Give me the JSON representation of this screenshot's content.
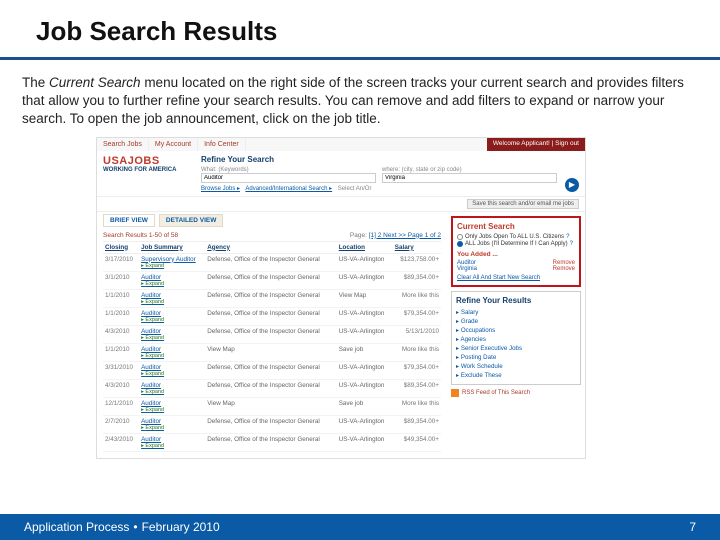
{
  "slide": {
    "title": "Job Search Results",
    "body": "The Current Search menu located on the right side of the screen tracks your current search and provides filters that allow you to further refine your search results.  You can remove and add filters to expand or narrow your search.  To open the job announcement, click on the job title."
  },
  "app": {
    "tabs": [
      "Search Jobs",
      "My Account",
      "Info Center"
    ],
    "welcome": "Welcome Applicant!  |  Sign out",
    "logo_l1": "USAJOBS",
    "logo_l2": "WORKING FOR AMERICA",
    "refine_label": "Refine Your Search",
    "what_label": "What: (Keywords)",
    "what_value": "Auditor",
    "where_label": "where: (city, state or zip code)",
    "where_value": "Virginia",
    "browse": "Browse Jobs ▸",
    "adv": "Advanced/International Search ▸",
    "any": "Select An/Or",
    "save_btn": "Save this search and/or email me jobs",
    "brief": "BRIEF VIEW",
    "detailed": "DETAILED VIEW",
    "sr_count": "Search Results 1-50 of 58",
    "page_lbl": "Page:",
    "page_links": "[1]  2   Next >>     Page 1 of 2",
    "cols": [
      "Closing",
      "Job Summary",
      "Agency",
      "Location",
      "Salary"
    ],
    "rows": [
      {
        "date": "3/17/2010",
        "title": "Supervisory Auditor",
        "agency": "Defense, Office of the Inspector General",
        "loc": "US-VA-Arlington",
        "sal": "$123,758.00+"
      },
      {
        "date": "3/1/2010",
        "title": "Auditor",
        "agency": "Defense, Office of the Inspector General",
        "loc": "US-VA-Arlington",
        "sal": "$89,354.00+"
      },
      {
        "date": "1/1/2010",
        "title": "Auditor",
        "agency": "Defense, Office of the Inspector General",
        "loc": "View Map",
        "sal": "More like this"
      },
      {
        "date": "1/1/2010",
        "title": "Auditor",
        "agency": "Defense, Office of the Inspector General",
        "loc": "US-VA-Arlington",
        "sal": "$79,354.00+"
      },
      {
        "date": "4/3/2010",
        "title": "Auditor",
        "agency": "Defense, Office of the Inspector General",
        "loc": "US-VA-Arlington",
        "sal": "5/13/1/2010"
      },
      {
        "date": "1/1/2010",
        "title": "Auditor",
        "agency": "View Map",
        "loc": "Save job",
        "sal": "More like this"
      },
      {
        "date": "3/31/2010",
        "title": "Auditor",
        "agency": "Defense, Office of the Inspector General",
        "loc": "US-VA-Arlington",
        "sal": "$79,354.00+"
      },
      {
        "date": "4/3/2010",
        "title": "Auditor",
        "agency": "Defense, Office of the Inspector General",
        "loc": "US-VA-Arlington",
        "sal": "$89,354.00+"
      },
      {
        "date": "12/1/2010",
        "title": "Auditor",
        "agency": "View Map",
        "loc": "Save job",
        "sal": "More like this"
      },
      {
        "date": "2/7/2010",
        "title": "Auditor",
        "agency": "Defense, Office of the Inspector General",
        "loc": "US-VA-Arlington",
        "sal": "$89,354.00+"
      },
      {
        "date": "2/43/2010",
        "title": "Auditor",
        "agency": "Defense, Office of the Inspector General",
        "loc": "US-VA-Arlington",
        "sal": "$49,354.00+"
      }
    ],
    "expand": "Expand",
    "current_search": "Current Search",
    "radio1": "Only Jobs Open To ALL U.S. Citizens",
    "radio2": "ALL Jobs (I'll Determine If I Can Apply)",
    "you_added": "You Added ...",
    "added": [
      {
        "nm": "Auditor",
        "rm": "Remove"
      },
      {
        "nm": "Virginia",
        "rm": "Remove"
      }
    ],
    "clear_all": "Clear All And Start New Search",
    "refine_results": "Refine Your Results",
    "refine_opts": [
      "Salary",
      "Grade",
      "Occupations",
      "Agencies",
      "Senior Executive Jobs",
      "Posting Date",
      "Work Schedule",
      "Exclude These"
    ],
    "rss": "RSS Feed of This Search"
  },
  "footer": {
    "left1": "Application Process",
    "left2": "February 2010",
    "page": "7"
  }
}
